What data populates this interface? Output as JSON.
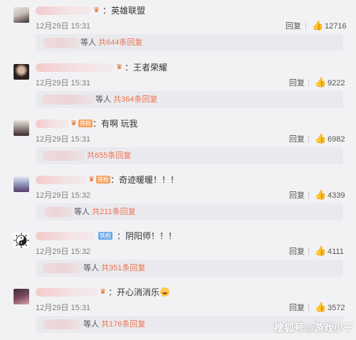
{
  "reply_label": "回复",
  "comments": [
    {
      "text": "：英雄联盟",
      "time": "12月29日 15:31",
      "likes": "12716",
      "sub_prefix": "等人",
      "sub_count": "共644条回复"
    },
    {
      "text": "：王者荣耀",
      "time": "12月29日 15:31",
      "likes": "9222",
      "sub_prefix": "等人",
      "sub_count": "共364条回复"
    },
    {
      "text": "：有啊 玩我",
      "badge": "铁粉",
      "time": "12月29日 15:31",
      "likes": "6982",
      "sub_prefix": "",
      "sub_count": "共655条回复"
    },
    {
      "text": "：奇迹暖暖！！！",
      "badge": "铁粉",
      "time": "12月29日 15:32",
      "likes": "4339",
      "sub_prefix": "等人",
      "sub_count": "共211条回复"
    },
    {
      "text": "：阴阳师！！！",
      "badge": "铁粉",
      "time": "12月29日 15:32",
      "likes": "4111",
      "sub_prefix": "等人",
      "sub_count": "共351条回复"
    },
    {
      "text": "：开心消消乐",
      "time": "12月29日 15:31",
      "likes": "3572",
      "sub_prefix": "等人",
      "sub_count": "共176条回复"
    }
  ],
  "watermark": "搜狐号@游戏小千",
  "icons": {
    "like": "thumbs-up-icon",
    "vip": "vip-crown-icon",
    "emoji": "laughing-emoji-icon"
  },
  "colors": {
    "accent": "#eb7350",
    "badge": "#f7a15a",
    "badge_blue": "#6aa8e8"
  }
}
